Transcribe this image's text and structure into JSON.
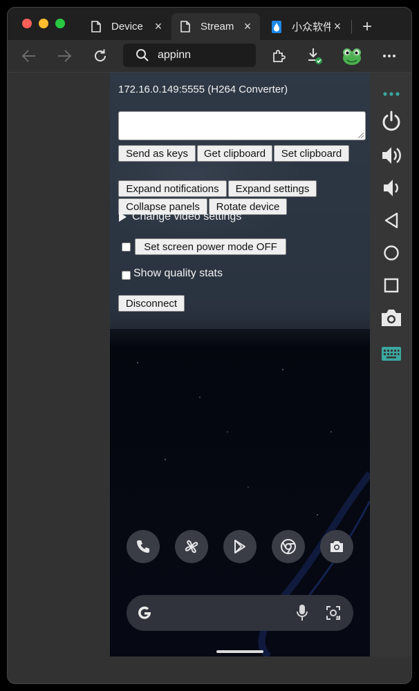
{
  "browser": {
    "tabs": [
      {
        "label": "Device ",
        "active": false,
        "icon": "page-icon"
      },
      {
        "label": "Stream ",
        "active": true,
        "icon": "page-icon"
      },
      {
        "label": "小众软件",
        "active": false,
        "icon": "water-drop-icon"
      }
    ],
    "new_tab_label": "+",
    "tab_close_label": "×",
    "address_text": "appinn",
    "colors": {
      "close_dot": "#ff5f57",
      "minimize_dot": "#febc2e",
      "maximize_dot": "#28c840",
      "drop_blue": "#1e88e5",
      "sidebar_accent": "#3aa8a0"
    }
  },
  "scrcpy": {
    "connection_title": "172.16.0.149:5555 (H264 Converter)",
    "input_value": "",
    "buttons": {
      "send_as_keys": "Send as keys",
      "get_clipboard": "Get clipboard",
      "set_clipboard": "Set clipboard",
      "expand_notifications": "Expand notifications",
      "expand_settings": "Expand settings",
      "collapse_panels": "Collapse panels",
      "rotate_device": "Rotate device",
      "set_screen_power_mode_off": "Set screen power mode OFF",
      "disconnect": "Disconnect"
    },
    "change_video_settings": "Change video settings",
    "show_quality_stats": "Show quality stats",
    "screen_power_checkbox_checked": false,
    "quality_stats_checkbox_checked": false
  },
  "phone": {
    "dock_apps": [
      "phone-icon",
      "fan-icon",
      "play-store-icon",
      "chrome-icon",
      "camera-icon"
    ],
    "search_bar_icons": [
      "google-g-icon",
      "microphone-icon",
      "lens-icon"
    ]
  },
  "side_controls": [
    "more-dots-icon",
    "power-icon",
    "volume-up-icon",
    "volume-down-icon",
    "back-icon",
    "home-icon",
    "overview-icon",
    "screenshot-icon",
    "keyboard-icon"
  ]
}
